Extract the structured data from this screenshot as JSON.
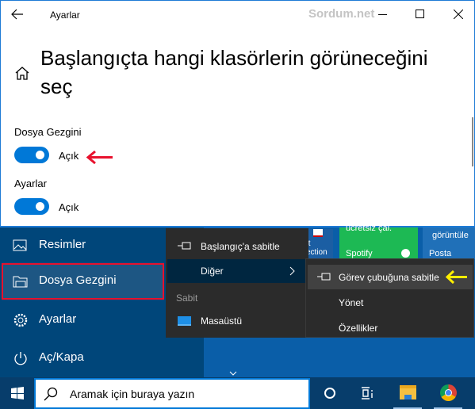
{
  "window": {
    "title": "Ayarlar",
    "watermark": "Sordum.net",
    "heading": "Başlangıçta hangi klasörlerin görüneceğini seç",
    "settings": [
      {
        "label": "Dosya Gezgini",
        "state": "Açık",
        "on": true
      },
      {
        "label": "Ayarlar",
        "state": "Açık",
        "on": true
      }
    ]
  },
  "start": {
    "items": [
      {
        "label": "Resimler",
        "icon": "pictures-icon"
      },
      {
        "label": "Dosya Gezgini",
        "icon": "file-explorer-icon",
        "highlighted": true
      },
      {
        "label": "Ayarlar",
        "icon": "gear-icon"
      },
      {
        "label": "Aç/Kapa",
        "icon": "power-icon"
      }
    ]
  },
  "tiles": [
    {
      "label": "ft\nection"
    },
    {
      "label": "ücretsiz çal.",
      "app": "Spotify"
    },
    {
      "label": "görüntüle",
      "app": "Posta"
    }
  ],
  "context_menu": {
    "pin_start": "Başlangıç'a sabitle",
    "more": "Diğer",
    "section": "Sabit",
    "desktop": "Masaüstü"
  },
  "submenu": {
    "pin_taskbar": "Görev çubuğuna sabitle",
    "manage": "Yönet",
    "properties": "Özellikler"
  },
  "taskbar": {
    "search_placeholder": "Aramak için buraya yazın"
  },
  "colors": {
    "accent": "#0078d7",
    "annotation_red": "#e8112d",
    "annotation_yellow": "#ffee00"
  }
}
